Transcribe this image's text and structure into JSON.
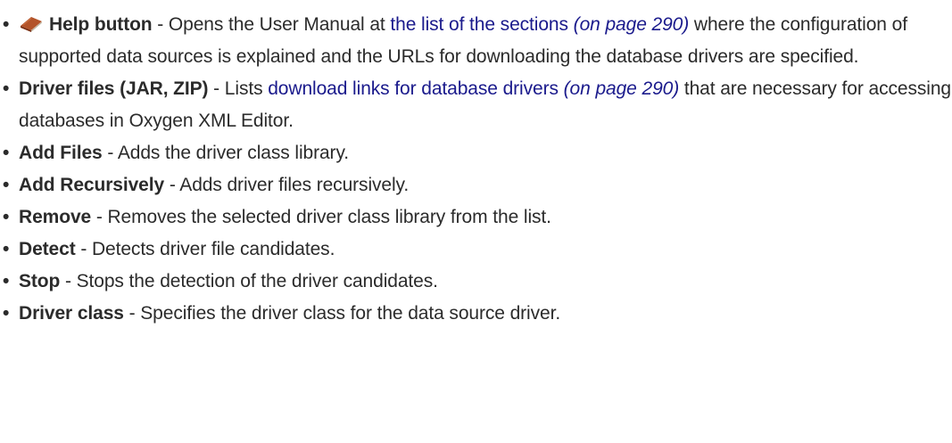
{
  "items": [
    {
      "icon": "help-book-icon",
      "term": "Help button",
      "pre": " - Opens the User Manual at ",
      "link": "the list of the sections",
      "pageref": "(on page 290)",
      "post": " where the configuration of supported data sources is explained and the URLs for downloading the database drivers are specified."
    },
    {
      "term": "Driver files (JAR, ZIP)",
      "pre": " - Lists ",
      "link": "download links for database drivers",
      "pageref": "(on page 290)",
      "post": " that are necessary for accessing databases in Oxygen XML Editor."
    },
    {
      "term": "Add Files",
      "desc": " - Adds the driver class library."
    },
    {
      "term": "Add Recursively",
      "desc": " - Adds driver files recursively."
    },
    {
      "term": "Remove",
      "desc": " - Removes the selected driver class library from the list."
    },
    {
      "term": "Detect",
      "desc": " - Detects driver file candidates."
    },
    {
      "term": "Stop",
      "desc": " - Stops the detection of the driver candidates."
    },
    {
      "term": "Driver class",
      "desc": " - Specifies the driver class for the data source driver."
    }
  ]
}
